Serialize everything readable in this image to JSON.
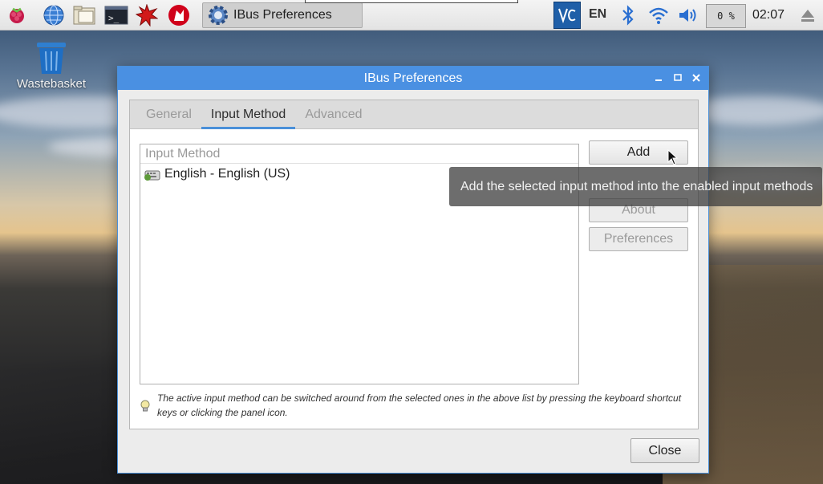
{
  "taskbar": {
    "task_title": "IBus Preferences",
    "language": "EN",
    "cpu": "0 %",
    "clock": "02:07"
  },
  "desktop": {
    "wastebasket_label": "Wastebasket"
  },
  "window": {
    "title": "IBus Preferences",
    "tabs": [
      {
        "label": "General"
      },
      {
        "label": "Input Method"
      },
      {
        "label": "Advanced"
      }
    ],
    "list_header": "Input Method",
    "items": [
      {
        "label": "English - English (US)"
      }
    ],
    "buttons": {
      "add": "Add",
      "about": "About",
      "preferences": "Preferences",
      "close": "Close"
    },
    "hint": "The active input method can be switched around from the selected ones in the above list by pressing the keyboard shortcut keys or clicking the panel icon."
  },
  "tooltip": "Add the selected input method into the enabled input methods",
  "colors": {
    "accent": "#4a90e2",
    "taskbar": "#ececec"
  }
}
